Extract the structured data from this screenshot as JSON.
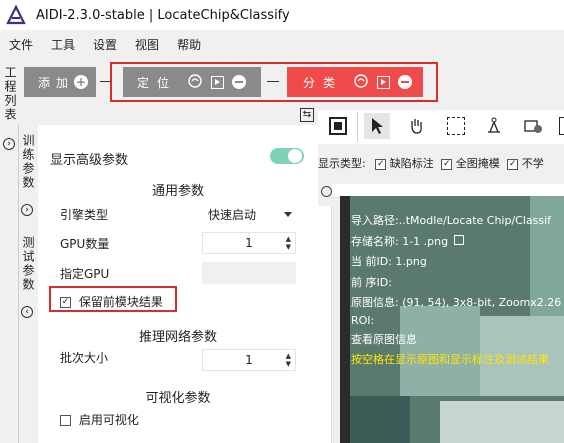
{
  "window": {
    "title": "AIDI-2.3.0-stable | LocateChip&Classify"
  },
  "menu": [
    "文件",
    "工具",
    "设置",
    "视图",
    "帮助"
  ],
  "side_tabs": {
    "project_list": "工程列表",
    "train_params": "训练参数",
    "test_params": "测试参数"
  },
  "toolbar": {
    "add_label": "添加",
    "locate_label": "定位",
    "classify_label": "分类"
  },
  "colors": {
    "accent_green": "#7dd3b5",
    "classify_red": "#f04b4b",
    "gray_btn": "#8a8a8a",
    "highlight_box": "#d32f2f",
    "info_yellow": "#ffe600"
  },
  "params": {
    "show_advanced": "显示高级参数",
    "general_section": "通用参数",
    "engine_type_label": "引擎类型",
    "engine_type_value": "快速启动",
    "gpu_count_label": "GPU数量",
    "gpu_count_value": "1",
    "specify_gpu_label": "指定GPU",
    "keep_prev_result": "保留前模块结果",
    "infer_section": "推理网络参数",
    "batch_size_label": "批次大小",
    "batch_size_value": "1",
    "vis_section": "可视化参数",
    "enable_vis": "启用可视化"
  },
  "display_options": {
    "label": "显示类型:",
    "defect_label": "缺陷标注",
    "full_mask": "全图掩模",
    "not_label": "不学"
  },
  "image_info": {
    "import_path": "导入路径:..tModle/Locate Chip/Classif",
    "save_name": "存储名称: 1-1 .png",
    "current_id": "当 前ID: 1.png",
    "prev_id": "前 序ID:",
    "original_info": "原图信息: (91, 54), 3x8-bit, Zoomx2.26",
    "roi": "ROI:",
    "view_original": "查看原图信息",
    "hint": "按空格在显示原图和显示标注及测试结果"
  }
}
